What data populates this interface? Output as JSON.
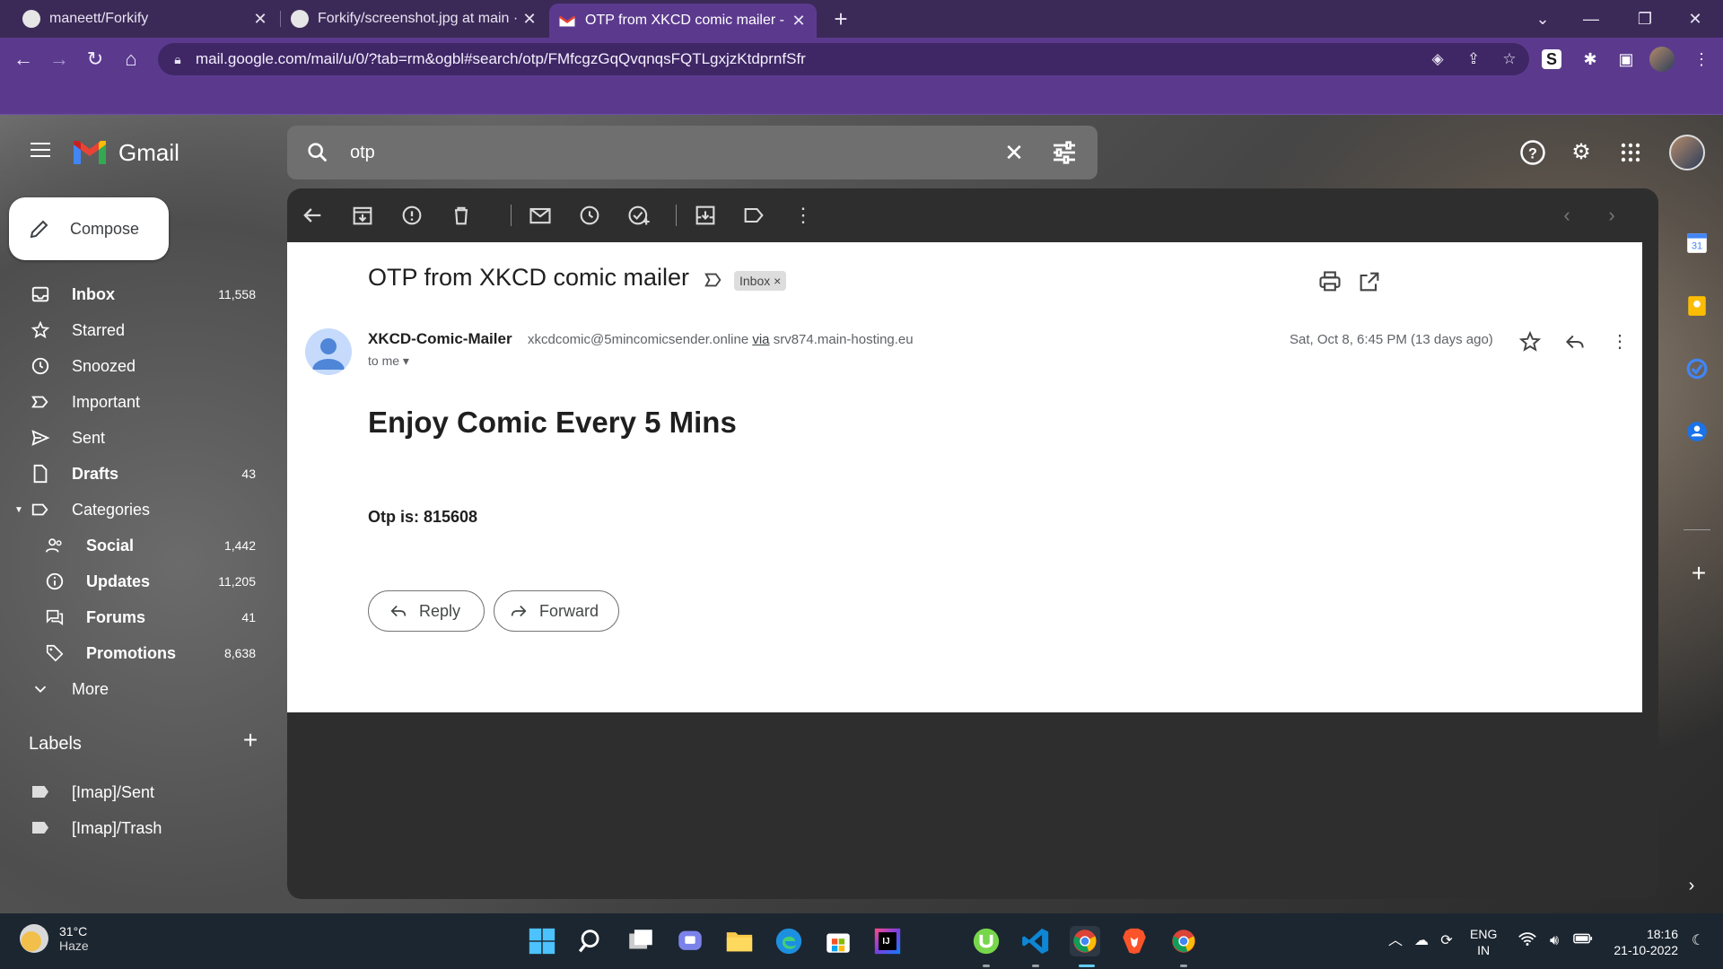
{
  "browser": {
    "tabs": [
      {
        "title": "maneett/Forkify"
      },
      {
        "title": "Forkify/screenshot.jpg at main · r"
      },
      {
        "title": "OTP from XKCD comic mailer - m"
      }
    ],
    "url": "mail.google.com/mail/u/0/?tab=rm&ogbl#search/otp/FMfcgzGqQvqnqsFQTLgxjzKtdprnfSfr"
  },
  "gmail": {
    "logo_text": "Gmail",
    "search_value": "otp",
    "compose_label": "Compose",
    "nav": [
      {
        "label": "Inbox",
        "count": "11,558"
      },
      {
        "label": "Starred",
        "count": ""
      },
      {
        "label": "Snoozed",
        "count": ""
      },
      {
        "label": "Important",
        "count": ""
      },
      {
        "label": "Sent",
        "count": ""
      },
      {
        "label": "Drafts",
        "count": "43"
      },
      {
        "label": "Categories",
        "count": ""
      },
      {
        "label": "Social",
        "count": "1,442"
      },
      {
        "label": "Updates",
        "count": "11,205"
      },
      {
        "label": "Forums",
        "count": "41"
      },
      {
        "label": "Promotions",
        "count": "8,638"
      },
      {
        "label": "More",
        "count": ""
      }
    ],
    "labels_heading": "Labels",
    "labels": [
      {
        "label": "[Imap]/Sent"
      },
      {
        "label": "[Imap]/Trash"
      }
    ]
  },
  "email": {
    "subject": "OTP from XKCD comic mailer",
    "chip": "Inbox",
    "sender_name": "XKCD-Comic-Mailer",
    "sender_email": "xkcdcomic@5mincomicsender.online",
    "via_label": "via",
    "via_server": "srv874.main-hosting.eu",
    "to": "to me",
    "date": "Sat, Oct 8, 6:45 PM (13 days ago)",
    "body_heading": "Enjoy Comic Every 5 Mins",
    "body_otp": "Otp is: 815608",
    "reply_label": "Reply",
    "forward_label": "Forward"
  },
  "taskbar": {
    "temperature": "31°C",
    "condition": "Haze",
    "language": "ENG",
    "region": "IN",
    "time": "18:16",
    "date": "21-10-2022"
  },
  "colors": {
    "tabstrip": "#3b2a57",
    "toolbar": "#5b3a8e",
    "panel": "#2e2e2e",
    "taskbar": "#1c2630"
  }
}
